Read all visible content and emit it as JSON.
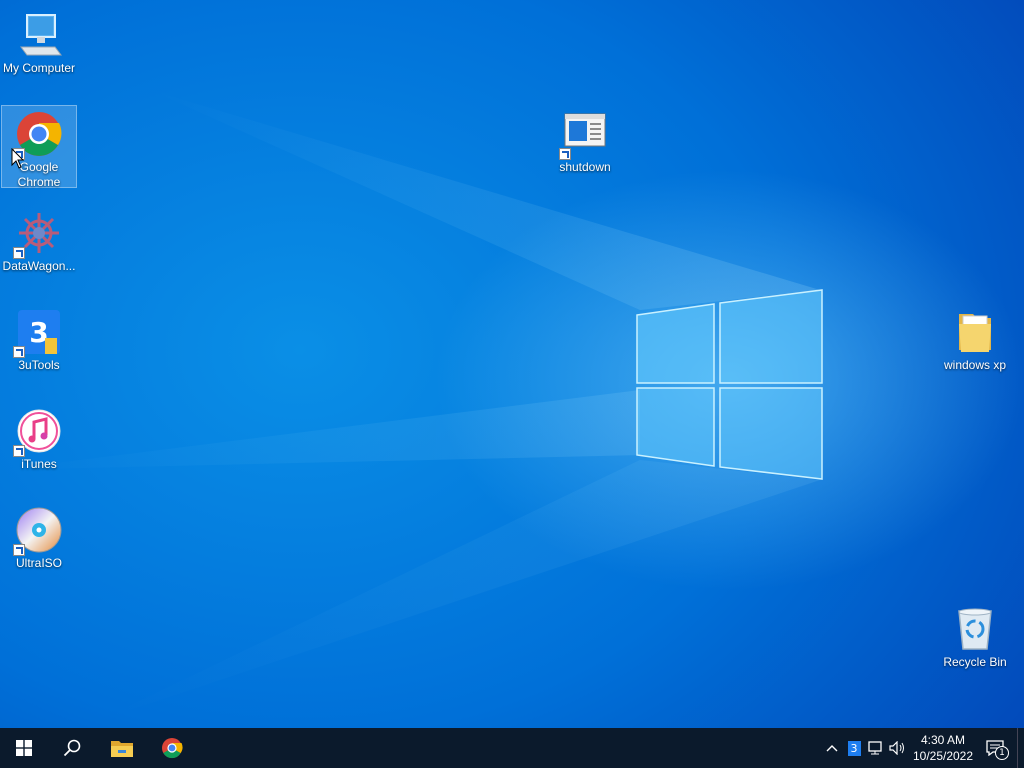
{
  "desktop": {
    "icons": [
      {
        "label": "My Computer",
        "icon": "computer-icon"
      },
      {
        "label": "Google Chrome",
        "icon": "chrome-icon",
        "selected": true
      },
      {
        "label": "DataWagon...",
        "icon": "datawagon-icon"
      },
      {
        "label": "3uTools",
        "icon": "3utools-icon"
      },
      {
        "label": "iTunes",
        "icon": "itunes-icon"
      },
      {
        "label": "UltraISO",
        "icon": "ultraiso-icon"
      },
      {
        "label": "shutdown",
        "icon": "shutdown-icon"
      },
      {
        "label": "windows xp",
        "icon": "folder-icon"
      },
      {
        "label": "Recycle Bin",
        "icon": "recycle-bin-icon"
      }
    ]
  },
  "taskbar": {
    "start": "start-icon",
    "search": "search-icon",
    "pinned": [
      "file-explorer-icon",
      "chrome-icon"
    ],
    "tray": {
      "chevron": "chevron-up-icon",
      "app_badge": "3",
      "network": "network-icon",
      "volume": "volume-icon",
      "time": "4:30 AM",
      "date": "10/25/2022",
      "notification_count": "1"
    }
  },
  "colors": {
    "wallpaper": "#0078d7",
    "taskbar": "#0b1a2c"
  }
}
